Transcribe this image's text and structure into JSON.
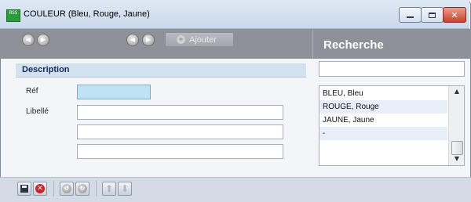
{
  "window": {
    "title": "COULEUR (Bleu, Rouge, Jaune)",
    "app_icon_text": "RSS",
    "controls": [
      "minimize-icon",
      "maximize-icon",
      "close-icon"
    ]
  },
  "toolbar": {
    "add_label": "Ajouter",
    "search_title": "Recherche"
  },
  "form": {
    "section_title": "Description",
    "ref_label": "Réf",
    "ref_value": "",
    "label_label": "Libellé",
    "label_values": [
      "",
      "",
      ""
    ]
  },
  "search": {
    "value": "",
    "results": [
      "BLEU, Bleu",
      "ROUGE, Rouge",
      "JAUNE, Jaune",
      "-"
    ]
  },
  "colors": {
    "toolbar_bg": "#8e9298",
    "ref_field_bg": "#bfe3f4",
    "section_bg": "#d3e0ee"
  }
}
